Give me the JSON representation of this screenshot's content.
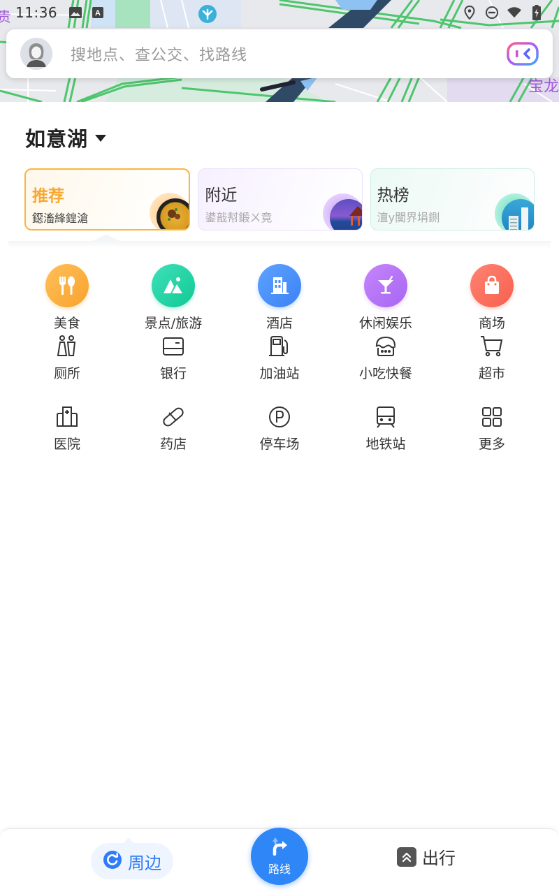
{
  "status_bar": {
    "time": "11:36",
    "left_icons": [
      "image-icon",
      "text-a-icon"
    ],
    "right_icons": [
      "location-pin-icon",
      "do-not-disturb-icon",
      "wifi-icon",
      "battery-charging-icon"
    ]
  },
  "map": {
    "poi_label_right": "宝龙",
    "poi_label_left": "贵"
  },
  "search": {
    "placeholder": "搜地点、查公交、找路线",
    "avatar_icon": "user-avatar-icon",
    "voice_icon": "voice-assistant-icon"
  },
  "location": {
    "name": "如意湖",
    "dropdown_icon": "caret-down-icon"
  },
  "cards": [
    {
      "id": "recommend",
      "title": "推荐",
      "subtitle": "鐚滀綘鍠滄",
      "selected": true,
      "accent": "#f8b53f"
    },
    {
      "id": "nearby",
      "title": "附近",
      "subtitle": "鍙戠幇鍛ㄨ竟",
      "selected": false,
      "accent": "#b98cf5"
    },
    {
      "id": "hot",
      "title": "热榜",
      "subtitle": "澶у闃界埍鍘",
      "selected": false,
      "accent": "#3fd6b0"
    }
  ],
  "categories_primary": [
    {
      "label": "美食",
      "icon": "fork-spoon-icon",
      "color": "#f9a832"
    },
    {
      "label": "景点/旅游",
      "icon": "mountain-icon",
      "color": "#1ecfa0"
    },
    {
      "label": "酒店",
      "icon": "building-icon",
      "color": "#4a8ef8"
    },
    {
      "label": "休闲娱乐",
      "icon": "cocktail-icon",
      "color": "#b372f5"
    },
    {
      "label": "商场",
      "icon": "shopping-bag-icon",
      "color": "#fa6a5a"
    }
  ],
  "categories_secondary": [
    {
      "label": "厕所",
      "icon": "restroom-icon"
    },
    {
      "label": "银行",
      "icon": "bank-card-icon"
    },
    {
      "label": "加油站",
      "icon": "gas-pump-icon"
    },
    {
      "label": "小吃快餐",
      "icon": "snack-icon"
    },
    {
      "label": "超市",
      "icon": "shopping-cart-icon"
    },
    {
      "label": "医院",
      "icon": "hospital-icon"
    },
    {
      "label": "药店",
      "icon": "pill-icon"
    },
    {
      "label": "停车场",
      "icon": "parking-icon"
    },
    {
      "label": "地铁站",
      "icon": "subway-icon"
    },
    {
      "label": "更多",
      "icon": "grid-more-icon"
    }
  ],
  "bottom_nav": {
    "around": {
      "label": "周边",
      "active": true,
      "color": "#2f7cf6"
    },
    "route": {
      "label": "路线",
      "color": "#2f86f6"
    },
    "travel": {
      "label": "出行"
    }
  }
}
